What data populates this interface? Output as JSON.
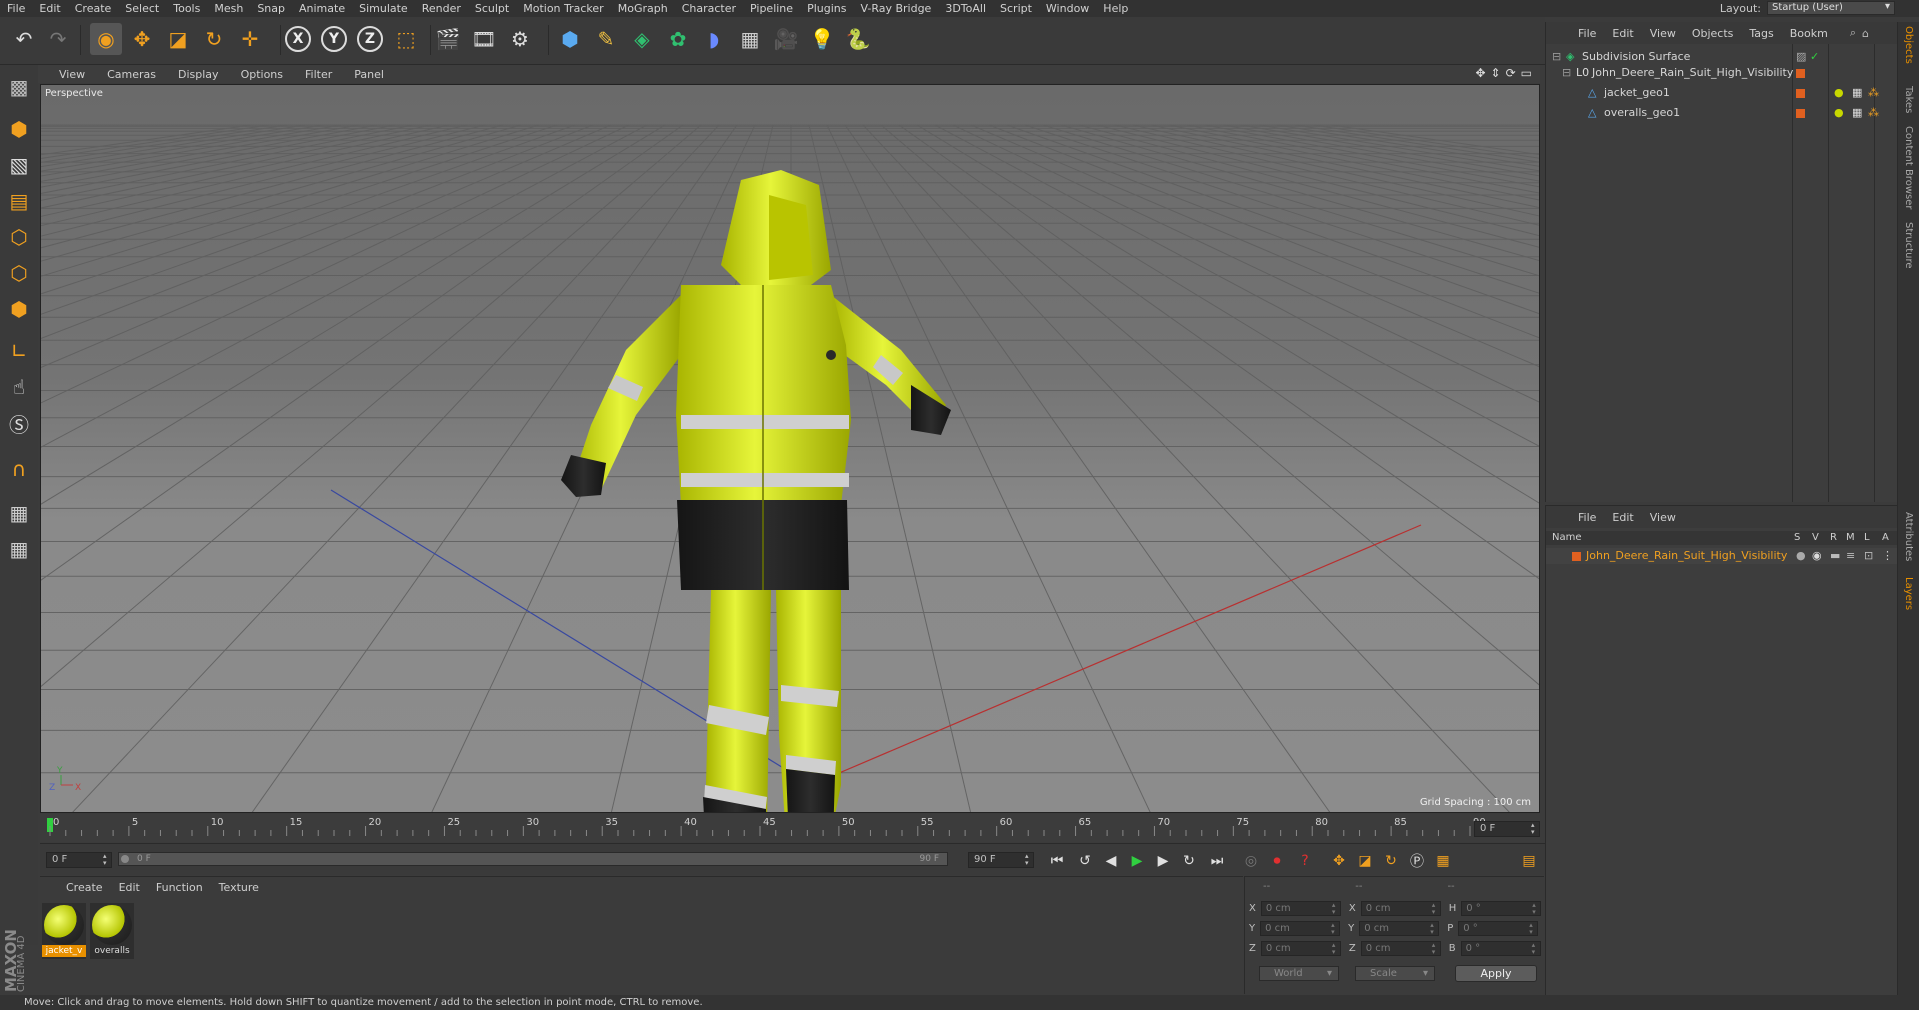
{
  "menubar": {
    "items": [
      "File",
      "Edit",
      "Create",
      "Select",
      "Tools",
      "Mesh",
      "Snap",
      "Animate",
      "Simulate",
      "Render",
      "Sculpt",
      "Motion Tracker",
      "MoGraph",
      "Character",
      "Pipeline",
      "Plugins",
      "V-Ray Bridge",
      "3DToAll",
      "Script",
      "Window",
      "Help"
    ],
    "layout_label": "Layout:",
    "layout_value": "Startup (User)"
  },
  "toolbar": {
    "axis_x": "X",
    "axis_y": "Y",
    "axis_z": "Z"
  },
  "viewport": {
    "menu": [
      "View",
      "Cameras",
      "Display",
      "Options",
      "Filter",
      "Panel"
    ],
    "label": "Perspective",
    "grid_spacing": "Grid Spacing : 100 cm",
    "axis_y": "Y",
    "axis_z": "Z",
    "axis_x": "X"
  },
  "timeline": {
    "ticks": [
      "0",
      "5",
      "10",
      "15",
      "20",
      "25",
      "30",
      "35",
      "40",
      "45",
      "50",
      "55",
      "60",
      "65",
      "70",
      "75",
      "80",
      "85",
      "90"
    ],
    "current_frame_right": "0 F"
  },
  "animbar": {
    "start_frame": "0 F",
    "slider_start": "0 F",
    "slider_end": "90 F",
    "end_frame": "90 F"
  },
  "material_manager": {
    "menu": [
      "Create",
      "Edit",
      "Function",
      "Texture"
    ],
    "materials": [
      {
        "name": "jacket_v",
        "active": true
      },
      {
        "name": "overalls",
        "active": false
      }
    ]
  },
  "coordinates": {
    "header_a": "--",
    "header_b": "--",
    "header_c": "--",
    "rows": [
      {
        "l1": "X",
        "v1": "0 cm",
        "l2": "X",
        "v2": "0 cm",
        "l3": "H",
        "v3": "0 °"
      },
      {
        "l1": "Y",
        "v1": "0 cm",
        "l2": "Y",
        "v2": "0 cm",
        "l3": "P",
        "v3": "0 °"
      },
      {
        "l1": "Z",
        "v1": "0 cm",
        "l2": "Z",
        "v2": "0 cm",
        "l3": "B",
        "v3": "0 °"
      }
    ],
    "space": "World",
    "mode": "Scale",
    "apply": "Apply"
  },
  "object_manager": {
    "menu": [
      "File",
      "Edit",
      "View",
      "Objects",
      "Tags",
      "Bookm"
    ],
    "objects": [
      {
        "name": "Subdivision Surface"
      },
      {
        "name": "John_Deere_Rain_Suit_High_Visibility"
      },
      {
        "name": "jacket_geo1"
      },
      {
        "name": "overalls_geo1"
      }
    ]
  },
  "layer_manager": {
    "menu": [
      "File",
      "Edit",
      "View"
    ],
    "header_name": "Name",
    "columns": [
      "S",
      "V",
      "R",
      "M",
      "L",
      "A"
    ],
    "layers": [
      {
        "name": "John_Deere_Rain_Suit_High_Visibility"
      }
    ]
  },
  "right_tabs": [
    "Objects",
    "Takes",
    "Content Browser",
    "Structure",
    "Attributes",
    "Layers"
  ],
  "brand": {
    "maxon": "MAXON",
    "product": "CINEMA 4D"
  },
  "status": "Move: Click and drag to move elements. Hold down SHIFT to quantize movement / add to the selection in point mode, CTRL to remove.",
  "colors": {
    "accent": "#e89000",
    "suit_yellow": "#d8e82a",
    "suit_black": "#1e1e1e",
    "reflective": "#c8c8c8"
  }
}
